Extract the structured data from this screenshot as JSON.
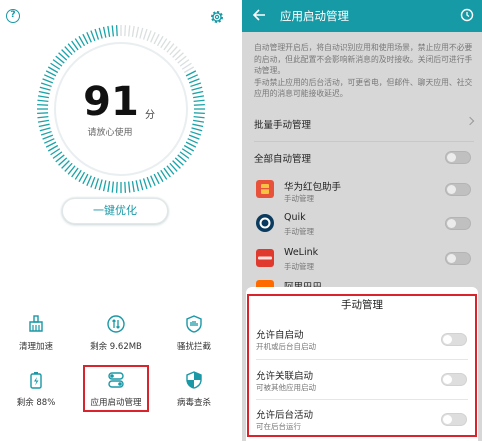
{
  "left": {
    "score": "91",
    "score_unit": "分",
    "status": "请放心使用",
    "optimize_button": "一键优化",
    "tools": [
      {
        "label": "清理加速",
        "icon": "broom-icon"
      },
      {
        "label": "剩余 9.62MB",
        "icon": "data-traffic-icon"
      },
      {
        "label": "骚扰拦截",
        "icon": "shield-block-icon"
      },
      {
        "label": "剩余 88%",
        "icon": "battery-icon"
      },
      {
        "label": "应用启动管理",
        "icon": "app-launch-icon"
      },
      {
        "label": "病毒查杀",
        "icon": "virus-scan-icon"
      }
    ],
    "colors": {
      "accent": "#1a98a6",
      "highlight": "#d8242a"
    }
  },
  "right": {
    "title": "应用启动管理",
    "description": [
      "自动管理开启后，将自动识别应用和使用场景，禁止应用不必要的启动，但此配置不会影响新消息的及时接收。关闭后可进行手动管理。",
      "手动禁止应用的后台活动，可更省电，但邮件、聊天应用、社交应用的消息可能接收延迟。"
    ],
    "batch_manual": "批量手动管理",
    "all_auto": "全部自动管理",
    "apps": [
      {
        "name": "华为红包助手",
        "sub": "手动管理",
        "color": "#e8523a"
      },
      {
        "name": "Quik",
        "sub": "手动管理",
        "color": "#0a3b5e"
      },
      {
        "name": "WeLink",
        "sub": "手动管理",
        "color": "#e03a2e"
      },
      {
        "name": "阿里巴巴",
        "sub": "",
        "color": "#ff6a00"
      }
    ],
    "sheet": {
      "title": "手动管理",
      "options": [
        {
          "title": "允许自启动",
          "sub": "开机或后台自启动"
        },
        {
          "title": "允许关联启动",
          "sub": "可被其他应用启动"
        },
        {
          "title": "允许后台活动",
          "sub": "可在后台运行"
        }
      ]
    },
    "colors": {
      "topbar": "#169aa6"
    }
  }
}
